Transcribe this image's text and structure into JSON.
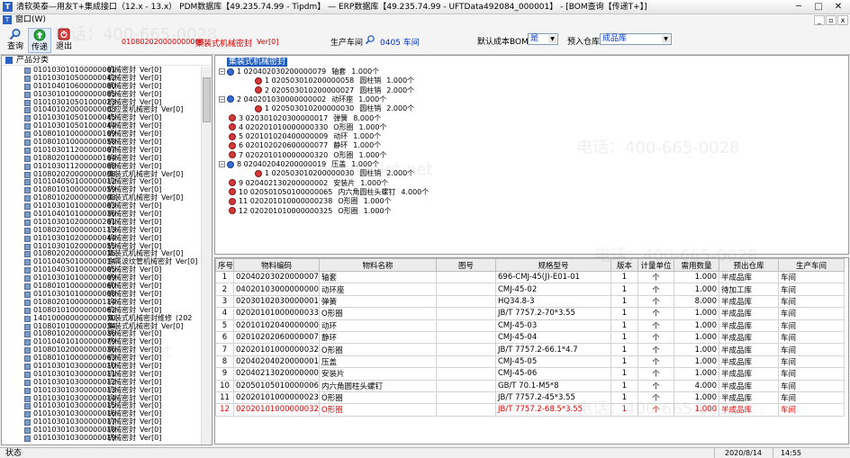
{
  "window": {
    "title": "清软英泰—用友T+集成接口（12.x - 13.x） PDM数据库【49.235.74.99 - Tipdm】 — ERP数据库【49.235.74.99 - UFTData492084_000001】 - [BOM查询【传递T+】]",
    "app_icon": "T",
    "minimize": "─",
    "maximize": "□",
    "close": "✕"
  },
  "menu": {
    "icon": "T",
    "item": "窗口(W)",
    "mdi_buttons": [
      "_",
      "▫",
      "x"
    ]
  },
  "toolbar": {
    "query_label": "查询",
    "transfer_label": "传递",
    "exit_label": "退出",
    "doc_code": "010802020000000008",
    "doc_name": "集装式机械密封",
    "doc_version": "Ver[0]",
    "workshop_label": "生产车间",
    "workshop_value": "0405 车间",
    "bom_label": "默认成本BOM",
    "bom_value": "是",
    "warehouse_label": "预入仓库",
    "warehouse_value": "成品库"
  },
  "left_panel": {
    "header": "产品分类",
    "items": [
      {
        "code": "010103010100000001",
        "name": "机械密封",
        "ver": "Ver[0]"
      },
      {
        "code": "010103010500000042",
        "name": "机械密封",
        "ver": "Ver[0]"
      },
      {
        "code": "010104010600000000",
        "name": "机械密封",
        "ver": "Ver[0]"
      },
      {
        "code": "010301010000000005",
        "name": "机械密封",
        "ver": "Ver[0]"
      },
      {
        "code": "010103010501000023",
        "name": "机械密封",
        "ver": "Ver[0]"
      },
      {
        "code": "010401020000000003",
        "name": "反应釜机械密封",
        "ver": "Ver[0]"
      },
      {
        "code": "010103010501000045",
        "name": "机械密封",
        "ver": "Ver[0]"
      },
      {
        "code": "010103010501000044",
        "name": "机械密封",
        "ver": "Ver[0]"
      },
      {
        "code": "010801010000000109",
        "name": "机械密封",
        "ver": "Ver[0]"
      },
      {
        "code": "010801010000000058",
        "name": "机械密封",
        "ver": "Ver[0]"
      },
      {
        "code": "010103011200000007",
        "name": "机械密封",
        "ver": "Ver[0]"
      },
      {
        "code": "010802010000000104",
        "name": "机械密封",
        "ver": "Ver[0]"
      },
      {
        "code": "010103011200000008",
        "name": "机械密封",
        "ver": "Ver[0]"
      },
      {
        "code": "010802020000000008",
        "name": "集装式机械密封",
        "ver": "Ver[0]"
      },
      {
        "code": "010104050100000012",
        "name": "机械密封",
        "ver": "Ver[0]"
      },
      {
        "code": "010801010000000059",
        "name": "机械密封",
        "ver": "Ver[0]"
      },
      {
        "code": "010801020000000003",
        "name": "集装式机械密封",
        "ver": "Ver[0]"
      },
      {
        "code": "010103010100000003",
        "name": "机械密封",
        "ver": "Ver[0]"
      },
      {
        "code": "010104010100000036",
        "name": "机械密封",
        "ver": "Ver[0]"
      },
      {
        "code": "010103010200000201",
        "name": "机械密封",
        "ver": "Ver[0]"
      },
      {
        "code": "010802010000000113",
        "name": "机械密封",
        "ver": "Ver[0]"
      },
      {
        "code": "010103010200000044",
        "name": "机械密封",
        "ver": "Ver[0]"
      },
      {
        "code": "010103010200000055",
        "name": "机械密封",
        "ver": "Ver[0]"
      },
      {
        "code": "010802020000000015",
        "name": "集装式机械密封",
        "ver": "Ver[0]"
      },
      {
        "code": "010104050100000014",
        "name": "金属波纹管机械密封",
        "ver": "Ver[0]"
      },
      {
        "code": "010104030100000005",
        "name": "机械密封",
        "ver": "Ver[0]"
      },
      {
        "code": "010103010100000009",
        "name": "机械密封",
        "ver": "Ver[0]"
      },
      {
        "code": "010801010000000060",
        "name": "机械密封",
        "ver": "Ver[0]"
      },
      {
        "code": "010103010100000008",
        "name": "机械密封",
        "ver": "Ver[0]"
      },
      {
        "code": "010802010000000114",
        "name": "机械密封",
        "ver": "Ver[0]"
      },
      {
        "code": "010801010000000062",
        "name": "机械密封",
        "ver": "Ver[0]"
      },
      {
        "code": "140100000000000070",
        "name": "集装式机械密封维修",
        "ver": "(202"
      },
      {
        "code": "010801010000000034",
        "name": "集装式机械密封",
        "ver": "Ver[0]"
      },
      {
        "code": "010801020000000036",
        "name": "机械密封",
        "ver": "Ver[0]"
      },
      {
        "code": "010104010100000079",
        "name": "机械密封",
        "ver": "Ver[0]"
      },
      {
        "code": "010801020000000036",
        "name": "机械密封",
        "ver": "Ver[0]"
      },
      {
        "code": "010801010000000063",
        "name": "机械密封",
        "ver": "Ver[0]"
      },
      {
        "code": "010103010300000010",
        "name": "机械密封",
        "ver": "Ver[0]"
      },
      {
        "code": "010103010300000011",
        "name": "机械密封",
        "ver": "Ver[0]"
      },
      {
        "code": "010103010300000012",
        "name": "机械密封",
        "ver": "Ver[0]"
      },
      {
        "code": "010103010300000013",
        "name": "机械密封",
        "ver": "Ver[0]"
      },
      {
        "code": "010103010300000014",
        "name": "机械密封",
        "ver": "Ver[0]"
      },
      {
        "code": "010103010300000015",
        "name": "机械密封",
        "ver": "Ver[0]"
      },
      {
        "code": "010103010300000016",
        "name": "机械密封",
        "ver": "Ver[0]"
      },
      {
        "code": "010103010300000017",
        "name": "机械密封",
        "ver": "Ver[0]"
      },
      {
        "code": "010103010300000018",
        "name": "机械密封",
        "ver": "Ver[0]"
      },
      {
        "code": "010103010300000019",
        "name": "机械密封",
        "ver": "Ver[0]"
      }
    ]
  },
  "tree": {
    "root": "集装式机械密封",
    "rows": [
      {
        "text": "1 020402030200000079",
        "name": "轴套",
        "qty": "1.000个",
        "level": 0,
        "blue": true,
        "exp": "−"
      },
      {
        "text": "1 020503010200000058",
        "name": "圆柱销",
        "qty": "1.000个",
        "level": 1,
        "blue": false,
        "exp": ""
      },
      {
        "text": "2 020503010200000027",
        "name": "圆柱销",
        "qty": "2.000个",
        "level": 1,
        "blue": false,
        "exp": ""
      },
      {
        "text": "2 040201030000000002",
        "name": "动环座",
        "qty": "1.000个",
        "level": 0,
        "blue": true,
        "exp": "−"
      },
      {
        "text": "1 020503010200000030",
        "name": "圆柱销",
        "qty": "2.000个",
        "level": 1,
        "blue": false,
        "exp": ""
      },
      {
        "text": "3 020301020300000017",
        "name": "弹簧",
        "qty": "8.000个",
        "level": 0,
        "blue": false,
        "exp": ""
      },
      {
        "text": "4 020201010000000330",
        "name": "O形圈",
        "qty": "1.000个",
        "level": 0,
        "blue": false,
        "exp": ""
      },
      {
        "text": "5 020101020400000009",
        "name": "动环",
        "qty": "1.000个",
        "level": 0,
        "blue": false,
        "exp": ""
      },
      {
        "text": "6 020102020600000077",
        "name": "静环",
        "qty": "1.000个",
        "level": 0,
        "blue": false,
        "exp": ""
      },
      {
        "text": "7 020201010000000320",
        "name": "O形圈",
        "qty": "1.000个",
        "level": 0,
        "blue": false,
        "exp": ""
      },
      {
        "text": "8 020402040200000019",
        "name": "压盖",
        "qty": "1.000个",
        "level": 0,
        "blue": true,
        "exp": "−"
      },
      {
        "text": "1 020503010200000030",
        "name": "圆柱销",
        "qty": "2.000个",
        "level": 1,
        "blue": false,
        "exp": ""
      },
      {
        "text": "9 020402130200000002",
        "name": "安装片",
        "qty": "1.000个",
        "level": 0,
        "blue": false,
        "exp": ""
      },
      {
        "text": "10 020501050100000065",
        "name": "内六角圆柱头螺钉",
        "qty": "4.000个",
        "level": 0,
        "blue": false,
        "exp": ""
      },
      {
        "text": "11 020201010000000238",
        "name": "O形圈",
        "qty": "1.000个",
        "level": 0,
        "blue": false,
        "exp": ""
      },
      {
        "text": "12 020201010000000325",
        "name": "O形圈",
        "qty": "1.000个",
        "level": 0,
        "blue": false,
        "exp": ""
      }
    ]
  },
  "grid": {
    "headers": [
      "序号",
      "物料编码",
      "物料名称",
      "图号",
      "规格型号",
      "版本",
      "计量单位",
      "需用数量",
      "预出仓库",
      "生产车间"
    ],
    "rows": [
      [
        "1",
        "020402030200000079",
        "轴套",
        "",
        "696-CMJ-45(J)-E01-01",
        "1",
        "个",
        "1.000",
        "半成品库",
        "车间"
      ],
      [
        "2",
        "040201030000000002",
        "动环座",
        "",
        "CMJ-45-02",
        "1",
        "个",
        "1.000",
        "待加工库",
        "车间"
      ],
      [
        "3",
        "020301020300000017",
        "弹簧",
        "",
        "HQ34.8-3",
        "1",
        "个",
        "8.000",
        "半成品库",
        "车间"
      ],
      [
        "4",
        "020201010000000330",
        "O形圈",
        "",
        "JB/T 7757.2-70*3.55",
        "1",
        "个",
        "1.000",
        "半成品库",
        "车间"
      ],
      [
        "5",
        "020101020400000009",
        "动环",
        "",
        "CMJ-45-03",
        "1",
        "个",
        "1.000",
        "半成品库",
        "车间"
      ],
      [
        "6",
        "020102020600000077",
        "静环",
        "",
        "CMJ-45-04",
        "1",
        "个",
        "1.000",
        "半成品库",
        "车间"
      ],
      [
        "7",
        "020201010000000320",
        "O形圈",
        "",
        "JB/T 7757.2-66.1*4.7",
        "1",
        "个",
        "1.000",
        "半成品库",
        "车间"
      ],
      [
        "8",
        "020402040200000019",
        "压盖",
        "",
        "CMJ-45-05",
        "1",
        "个",
        "1.000",
        "半成品库",
        "车间"
      ],
      [
        "9",
        "020402130200000002",
        "安装片",
        "",
        "CMJ-45-06",
        "1",
        "个",
        "1.000",
        "半成品库",
        "车间"
      ],
      [
        "10",
        "020501050100000065",
        "内六角圆柱头螺钉",
        "",
        "GB/T 70.1-M5*8",
        "1",
        "个",
        "4.000",
        "半成品库",
        "车间"
      ],
      [
        "11",
        "020201010000000238",
        "O形圈",
        "",
        "JB/T 7757.2-45*3.55",
        "1",
        "个",
        "1.000",
        "半成品库",
        "车间"
      ],
      [
        "12",
        "020201010000000325",
        "O形圈",
        "",
        "JB/T 7757.2-68.5*3.55",
        "1",
        "个",
        "1.000",
        "半成品库",
        "车间"
      ]
    ],
    "highlight_row": 11
  },
  "status": {
    "label": "状态",
    "date": "2020/8/14",
    "time": "14:55"
  },
  "watermarks": [
    "电话：400-665-0028",
    "www.chanjet.net"
  ],
  "colors": {
    "accent_red": "#d40000",
    "selection_blue": "#1f5dbd",
    "link_blue": "#0033cc"
  }
}
